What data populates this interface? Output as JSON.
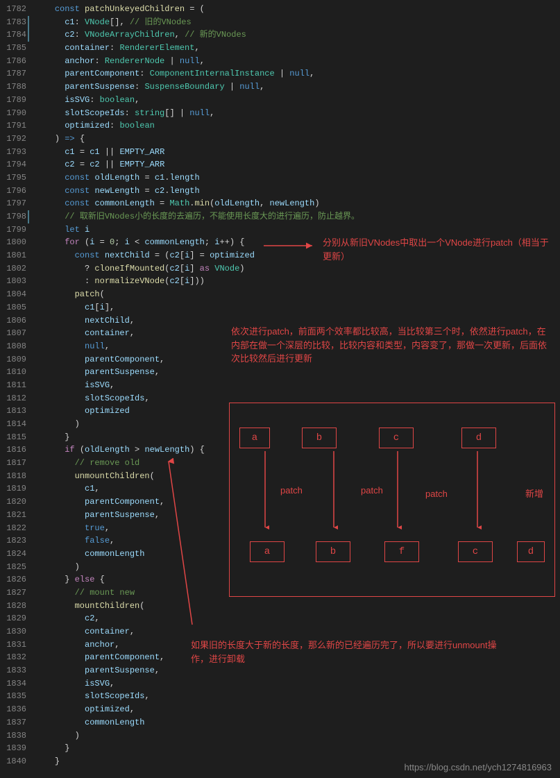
{
  "lineStart": 1782,
  "lineEnd": 1840,
  "highlightedGutterLines": [
    1783,
    1784,
    1798
  ],
  "code": [
    {
      "indent": 2,
      "tokens": [
        {
          "t": "kw",
          "v": "const"
        },
        {
          "t": "op",
          "v": " "
        },
        {
          "t": "fn",
          "v": "patchUnkeyedChildren"
        },
        {
          "t": "op",
          "v": " = ("
        }
      ]
    },
    {
      "indent": 3,
      "tokens": [
        {
          "t": "var",
          "v": "c1"
        },
        {
          "t": "op",
          "v": ": "
        },
        {
          "t": "type",
          "v": "VNode"
        },
        {
          "t": "op",
          "v": "[], "
        },
        {
          "t": "cmt",
          "v": "// 旧的VNodes"
        }
      ]
    },
    {
      "indent": 3,
      "tokens": [
        {
          "t": "var",
          "v": "c2"
        },
        {
          "t": "op",
          "v": ": "
        },
        {
          "t": "type",
          "v": "VNodeArrayChildren"
        },
        {
          "t": "op",
          "v": ", "
        },
        {
          "t": "cmt",
          "v": "// 新的VNodes"
        }
      ]
    },
    {
      "indent": 3,
      "tokens": [
        {
          "t": "var",
          "v": "container"
        },
        {
          "t": "op",
          "v": ": "
        },
        {
          "t": "type",
          "v": "RendererElement"
        },
        {
          "t": "op",
          "v": ","
        }
      ]
    },
    {
      "indent": 3,
      "tokens": [
        {
          "t": "var",
          "v": "anchor"
        },
        {
          "t": "op",
          "v": ": "
        },
        {
          "t": "type",
          "v": "RendererNode"
        },
        {
          "t": "op",
          "v": " | "
        },
        {
          "t": "kw",
          "v": "null"
        },
        {
          "t": "op",
          "v": ","
        }
      ]
    },
    {
      "indent": 3,
      "tokens": [
        {
          "t": "var",
          "v": "parentComponent"
        },
        {
          "t": "op",
          "v": ": "
        },
        {
          "t": "type",
          "v": "ComponentInternalInstance"
        },
        {
          "t": "op",
          "v": " | "
        },
        {
          "t": "kw",
          "v": "null"
        },
        {
          "t": "op",
          "v": ","
        }
      ]
    },
    {
      "indent": 3,
      "tokens": [
        {
          "t": "var",
          "v": "parentSuspense"
        },
        {
          "t": "op",
          "v": ": "
        },
        {
          "t": "type",
          "v": "SuspenseBoundary"
        },
        {
          "t": "op",
          "v": " | "
        },
        {
          "t": "kw",
          "v": "null"
        },
        {
          "t": "op",
          "v": ","
        }
      ]
    },
    {
      "indent": 3,
      "tokens": [
        {
          "t": "var",
          "v": "isSVG"
        },
        {
          "t": "op",
          "v": ": "
        },
        {
          "t": "type",
          "v": "boolean"
        },
        {
          "t": "op",
          "v": ","
        }
      ]
    },
    {
      "indent": 3,
      "tokens": [
        {
          "t": "var",
          "v": "slotScopeIds"
        },
        {
          "t": "op",
          "v": ": "
        },
        {
          "t": "type",
          "v": "string"
        },
        {
          "t": "op",
          "v": "[] | "
        },
        {
          "t": "kw",
          "v": "null"
        },
        {
          "t": "op",
          "v": ","
        }
      ]
    },
    {
      "indent": 3,
      "tokens": [
        {
          "t": "var",
          "v": "optimized"
        },
        {
          "t": "op",
          "v": ": "
        },
        {
          "t": "type",
          "v": "boolean"
        }
      ]
    },
    {
      "indent": 2,
      "tokens": [
        {
          "t": "op",
          "v": ") "
        },
        {
          "t": "kw",
          "v": "=>"
        },
        {
          "t": "op",
          "v": " {"
        }
      ]
    },
    {
      "indent": 3,
      "tokens": [
        {
          "t": "var",
          "v": "c1"
        },
        {
          "t": "op",
          "v": " = "
        },
        {
          "t": "var",
          "v": "c1"
        },
        {
          "t": "op",
          "v": " || "
        },
        {
          "t": "const",
          "v": "EMPTY_ARR"
        }
      ]
    },
    {
      "indent": 3,
      "tokens": [
        {
          "t": "var",
          "v": "c2"
        },
        {
          "t": "op",
          "v": " = "
        },
        {
          "t": "var",
          "v": "c2"
        },
        {
          "t": "op",
          "v": " || "
        },
        {
          "t": "const",
          "v": "EMPTY_ARR"
        }
      ]
    },
    {
      "indent": 3,
      "tokens": [
        {
          "t": "kw",
          "v": "const"
        },
        {
          "t": "op",
          "v": " "
        },
        {
          "t": "var",
          "v": "oldLength"
        },
        {
          "t": "op",
          "v": " = "
        },
        {
          "t": "var",
          "v": "c1"
        },
        {
          "t": "op",
          "v": "."
        },
        {
          "t": "var",
          "v": "length"
        }
      ]
    },
    {
      "indent": 3,
      "tokens": [
        {
          "t": "kw",
          "v": "const"
        },
        {
          "t": "op",
          "v": " "
        },
        {
          "t": "var",
          "v": "newLength"
        },
        {
          "t": "op",
          "v": " = "
        },
        {
          "t": "var",
          "v": "c2"
        },
        {
          "t": "op",
          "v": "."
        },
        {
          "t": "var",
          "v": "length"
        }
      ]
    },
    {
      "indent": 3,
      "tokens": [
        {
          "t": "kw",
          "v": "const"
        },
        {
          "t": "op",
          "v": " "
        },
        {
          "t": "var",
          "v": "commonLength"
        },
        {
          "t": "op",
          "v": " = "
        },
        {
          "t": "type",
          "v": "Math"
        },
        {
          "t": "op",
          "v": "."
        },
        {
          "t": "fn",
          "v": "min"
        },
        {
          "t": "op",
          "v": "("
        },
        {
          "t": "var",
          "v": "oldLength"
        },
        {
          "t": "op",
          "v": ", "
        },
        {
          "t": "var",
          "v": "newLength"
        },
        {
          "t": "op",
          "v": ")"
        }
      ]
    },
    {
      "indent": 3,
      "tokens": [
        {
          "t": "cmt",
          "v": "// 取新旧VNodes小的长度的去遍历，不能使用长度大的进行遍历，防止越界。"
        }
      ]
    },
    {
      "indent": 3,
      "tokens": [
        {
          "t": "kw",
          "v": "let"
        },
        {
          "t": "op",
          "v": " "
        },
        {
          "t": "var",
          "v": "i"
        }
      ]
    },
    {
      "indent": 3,
      "tokens": [
        {
          "t": "ctrl",
          "v": "for"
        },
        {
          "t": "op",
          "v": " ("
        },
        {
          "t": "var",
          "v": "i"
        },
        {
          "t": "op",
          "v": " = "
        },
        {
          "t": "num",
          "v": "0"
        },
        {
          "t": "op",
          "v": "; "
        },
        {
          "t": "var",
          "v": "i"
        },
        {
          "t": "op",
          "v": " < "
        },
        {
          "t": "var",
          "v": "commonLength"
        },
        {
          "t": "op",
          "v": "; "
        },
        {
          "t": "var",
          "v": "i"
        },
        {
          "t": "op",
          "v": "++) {"
        }
      ]
    },
    {
      "indent": 4,
      "tokens": [
        {
          "t": "kw",
          "v": "const"
        },
        {
          "t": "op",
          "v": " "
        },
        {
          "t": "var",
          "v": "nextChild"
        },
        {
          "t": "op",
          "v": " = ("
        },
        {
          "t": "var",
          "v": "c2"
        },
        {
          "t": "op",
          "v": "["
        },
        {
          "t": "var",
          "v": "i"
        },
        {
          "t": "op",
          "v": "] = "
        },
        {
          "t": "var",
          "v": "optimized"
        }
      ]
    },
    {
      "indent": 5,
      "tokens": [
        {
          "t": "op",
          "v": "? "
        },
        {
          "t": "fn",
          "v": "cloneIfMounted"
        },
        {
          "t": "op",
          "v": "("
        },
        {
          "t": "var",
          "v": "c2"
        },
        {
          "t": "op",
          "v": "["
        },
        {
          "t": "var",
          "v": "i"
        },
        {
          "t": "op",
          "v": "] "
        },
        {
          "t": "ctrl",
          "v": "as"
        },
        {
          "t": "op",
          "v": " "
        },
        {
          "t": "type",
          "v": "VNode"
        },
        {
          "t": "op",
          "v": ")"
        }
      ]
    },
    {
      "indent": 5,
      "tokens": [
        {
          "t": "op",
          "v": ": "
        },
        {
          "t": "fn",
          "v": "normalizeVNode"
        },
        {
          "t": "op",
          "v": "("
        },
        {
          "t": "var",
          "v": "c2"
        },
        {
          "t": "op",
          "v": "["
        },
        {
          "t": "var",
          "v": "i"
        },
        {
          "t": "op",
          "v": "]))"
        }
      ]
    },
    {
      "indent": 4,
      "tokens": [
        {
          "t": "fn",
          "v": "patch"
        },
        {
          "t": "op",
          "v": "("
        }
      ]
    },
    {
      "indent": 5,
      "tokens": [
        {
          "t": "var",
          "v": "c1"
        },
        {
          "t": "op",
          "v": "["
        },
        {
          "t": "var",
          "v": "i"
        },
        {
          "t": "op",
          "v": "],"
        }
      ]
    },
    {
      "indent": 5,
      "tokens": [
        {
          "t": "var",
          "v": "nextChild"
        },
        {
          "t": "op",
          "v": ","
        }
      ]
    },
    {
      "indent": 5,
      "tokens": [
        {
          "t": "var",
          "v": "container"
        },
        {
          "t": "op",
          "v": ","
        }
      ]
    },
    {
      "indent": 5,
      "tokens": [
        {
          "t": "kw",
          "v": "null"
        },
        {
          "t": "op",
          "v": ","
        }
      ]
    },
    {
      "indent": 5,
      "tokens": [
        {
          "t": "var",
          "v": "parentComponent"
        },
        {
          "t": "op",
          "v": ","
        }
      ]
    },
    {
      "indent": 5,
      "tokens": [
        {
          "t": "var",
          "v": "parentSuspense"
        },
        {
          "t": "op",
          "v": ","
        }
      ]
    },
    {
      "indent": 5,
      "tokens": [
        {
          "t": "var",
          "v": "isSVG"
        },
        {
          "t": "op",
          "v": ","
        }
      ]
    },
    {
      "indent": 5,
      "tokens": [
        {
          "t": "var",
          "v": "slotScopeIds"
        },
        {
          "t": "op",
          "v": ","
        }
      ]
    },
    {
      "indent": 5,
      "tokens": [
        {
          "t": "var",
          "v": "optimized"
        }
      ]
    },
    {
      "indent": 4,
      "tokens": [
        {
          "t": "op",
          "v": ")"
        }
      ]
    },
    {
      "indent": 3,
      "tokens": [
        {
          "t": "op",
          "v": "}"
        }
      ]
    },
    {
      "indent": 3,
      "tokens": [
        {
          "t": "ctrl",
          "v": "if"
        },
        {
          "t": "op",
          "v": " ("
        },
        {
          "t": "var",
          "v": "oldLength"
        },
        {
          "t": "op",
          "v": " > "
        },
        {
          "t": "var",
          "v": "newLength"
        },
        {
          "t": "op",
          "v": ") {"
        }
      ]
    },
    {
      "indent": 4,
      "tokens": [
        {
          "t": "cmt",
          "v": "// remove old"
        }
      ]
    },
    {
      "indent": 4,
      "tokens": [
        {
          "t": "fn",
          "v": "unmountChildren"
        },
        {
          "t": "op",
          "v": "("
        }
      ]
    },
    {
      "indent": 5,
      "tokens": [
        {
          "t": "var",
          "v": "c1"
        },
        {
          "t": "op",
          "v": ","
        }
      ]
    },
    {
      "indent": 5,
      "tokens": [
        {
          "t": "var",
          "v": "parentComponent"
        },
        {
          "t": "op",
          "v": ","
        }
      ]
    },
    {
      "indent": 5,
      "tokens": [
        {
          "t": "var",
          "v": "parentSuspense"
        },
        {
          "t": "op",
          "v": ","
        }
      ]
    },
    {
      "indent": 5,
      "tokens": [
        {
          "t": "kw",
          "v": "true"
        },
        {
          "t": "op",
          "v": ","
        }
      ]
    },
    {
      "indent": 5,
      "tokens": [
        {
          "t": "kw",
          "v": "false"
        },
        {
          "t": "op",
          "v": ","
        }
      ]
    },
    {
      "indent": 5,
      "tokens": [
        {
          "t": "var",
          "v": "commonLength"
        }
      ]
    },
    {
      "indent": 4,
      "tokens": [
        {
          "t": "op",
          "v": ")"
        }
      ]
    },
    {
      "indent": 3,
      "tokens": [
        {
          "t": "op",
          "v": "} "
        },
        {
          "t": "ctrl",
          "v": "else"
        },
        {
          "t": "op",
          "v": " {"
        }
      ]
    },
    {
      "indent": 4,
      "tokens": [
        {
          "t": "cmt",
          "v": "// mount new"
        }
      ]
    },
    {
      "indent": 4,
      "tokens": [
        {
          "t": "fn",
          "v": "mountChildren"
        },
        {
          "t": "op",
          "v": "("
        }
      ]
    },
    {
      "indent": 5,
      "tokens": [
        {
          "t": "var",
          "v": "c2"
        },
        {
          "t": "op",
          "v": ","
        }
      ]
    },
    {
      "indent": 5,
      "tokens": [
        {
          "t": "var",
          "v": "container"
        },
        {
          "t": "op",
          "v": ","
        }
      ]
    },
    {
      "indent": 5,
      "tokens": [
        {
          "t": "var",
          "v": "anchor"
        },
        {
          "t": "op",
          "v": ","
        }
      ]
    },
    {
      "indent": 5,
      "tokens": [
        {
          "t": "var",
          "v": "parentComponent"
        },
        {
          "t": "op",
          "v": ","
        }
      ]
    },
    {
      "indent": 5,
      "tokens": [
        {
          "t": "var",
          "v": "parentSuspense"
        },
        {
          "t": "op",
          "v": ","
        }
      ]
    },
    {
      "indent": 5,
      "tokens": [
        {
          "t": "var",
          "v": "isSVG"
        },
        {
          "t": "op",
          "v": ","
        }
      ]
    },
    {
      "indent": 5,
      "tokens": [
        {
          "t": "var",
          "v": "slotScopeIds"
        },
        {
          "t": "op",
          "v": ","
        }
      ]
    },
    {
      "indent": 5,
      "tokens": [
        {
          "t": "var",
          "v": "optimized"
        },
        {
          "t": "op",
          "v": ","
        }
      ]
    },
    {
      "indent": 5,
      "tokens": [
        {
          "t": "var",
          "v": "commonLength"
        }
      ]
    },
    {
      "indent": 4,
      "tokens": [
        {
          "t": "op",
          "v": ")"
        }
      ]
    },
    {
      "indent": 3,
      "tokens": [
        {
          "t": "op",
          "v": "}"
        }
      ]
    },
    {
      "indent": 2,
      "tokens": [
        {
          "t": "op",
          "v": "}"
        }
      ]
    }
  ],
  "annotations": {
    "a1": "分别从新旧VNodes中取出一个VNode进行patch（相当于更新）",
    "a2": "依次进行patch，前面两个效率都比较高，当比较第三个时，依然进行patch，在内部在做一个深层的比较，比较内容和类型，内容变了，那做一次更新，后面依次比较然后进行更新",
    "a3": "如果旧的长度大于新的长度，那么新的已经遍历完了，所以要进行unmount操作，进行卸载",
    "patchLabel": "patch",
    "newAddLabel": "新增"
  },
  "diagram": {
    "topRow": [
      "a",
      "b",
      "c",
      "d"
    ],
    "bottomRow": [
      "a",
      "b",
      "f",
      "c",
      "d"
    ]
  },
  "watermark": "https://blog.csdn.net/ych1274816963"
}
